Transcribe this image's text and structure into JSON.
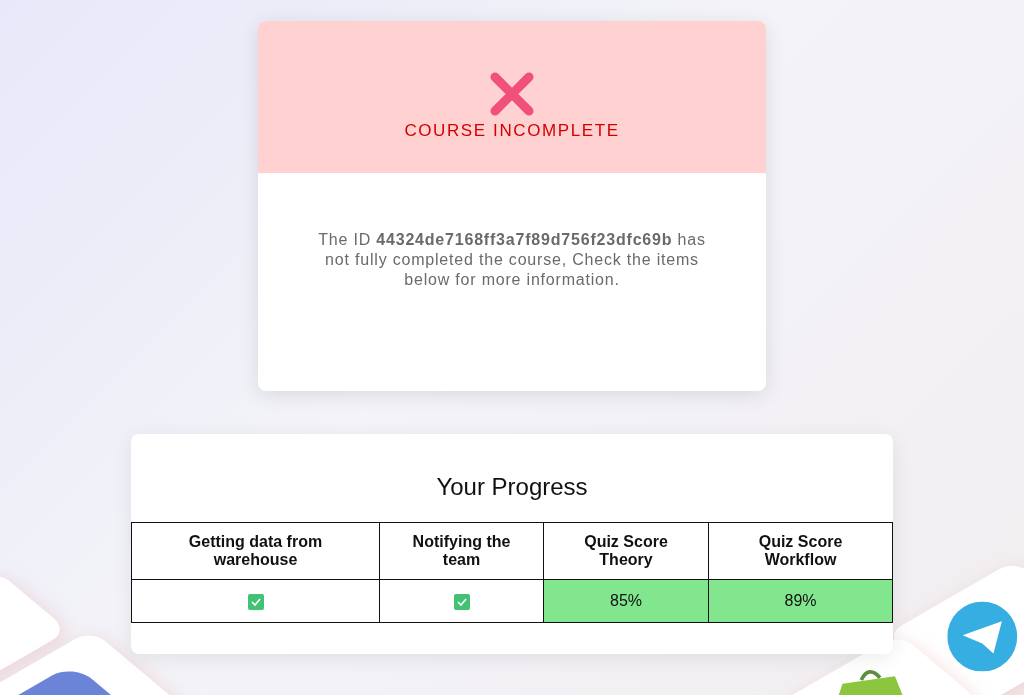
{
  "status_card": {
    "complete": false,
    "title": "COURSE INCOMPLETE",
    "message": "The ID **44324de7168ff3a7f89d756f23dfc69b** has not fully completed the course, Check the items below for more information."
  },
  "progress": {
    "title": "Your Progress",
    "columns": [
      "Getting data from warehouse",
      "Notifying the team",
      "Quiz Score Theory",
      "Quiz Score Workflow"
    ],
    "cells": [
      {
        "kind": "check",
        "checked": true
      },
      {
        "kind": "check",
        "checked": true
      },
      {
        "kind": "score",
        "text": "85%",
        "passed": true
      },
      {
        "kind": "score",
        "text": "89%",
        "passed": true
      }
    ]
  }
}
